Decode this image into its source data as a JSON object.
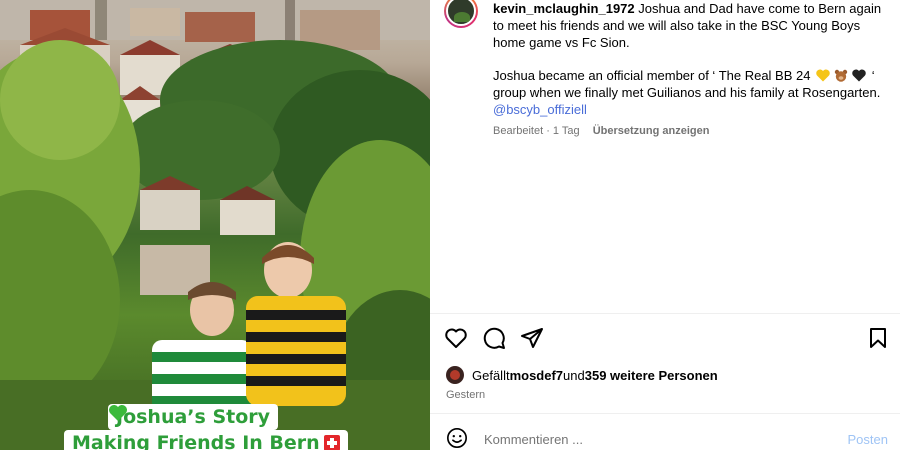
{
  "photo": {
    "overlay_line1": "Joshua’s Story",
    "overlay_line2": "Making Friends In Bern"
  },
  "post": {
    "username": "kevin_mclaughin_1972",
    "caption_p1": " Joshua and Dad have come to Bern again to meet his friends and we will also take in the BSC Young Boys home game vs Fc Sion.",
    "caption_p2_start": "Joshua became an official member of ‘ The Real BB 24 ",
    "caption_p2_end": " ‘ group when we finally met Guilianos and his family at Rosengarten.",
    "mention": "@bscyb_offiziell",
    "edited": "Bearbeitet · 1 Tag",
    "translate": "Übersetzung anzeigen"
  },
  "likes": {
    "prefix": "Gefällt ",
    "user": "mosdef7",
    "middle": " und ",
    "others": "359 weitere Personen"
  },
  "date": "Gestern",
  "comment": {
    "placeholder": "Kommentieren ...",
    "post_label": "Posten"
  },
  "icons": [
    "heart-icon",
    "comment-icon",
    "share-icon",
    "bookmark-icon",
    "emoji-icon"
  ],
  "colors": {
    "link": "#4a6dd8",
    "muted": "#737373",
    "post_button": "#9fc4f5",
    "overlay_text": "#2e9e3a"
  }
}
